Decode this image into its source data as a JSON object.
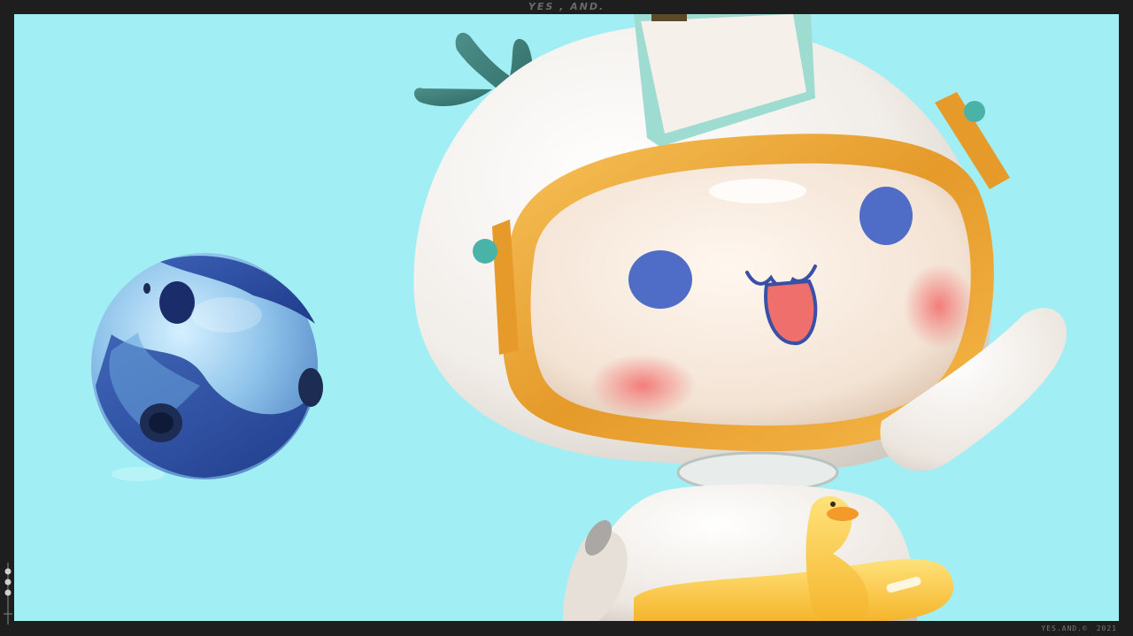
{
  "header": {
    "title": "YES , AND."
  },
  "footer": {
    "credit": "YES.AND.©",
    "year": "2021"
  },
  "scene": {
    "background_color": "#a1eff5",
    "frame_color": "#1e1e1e",
    "subjects": [
      "astronaut-character-figure",
      "blue-glass-planet-orb"
    ]
  }
}
